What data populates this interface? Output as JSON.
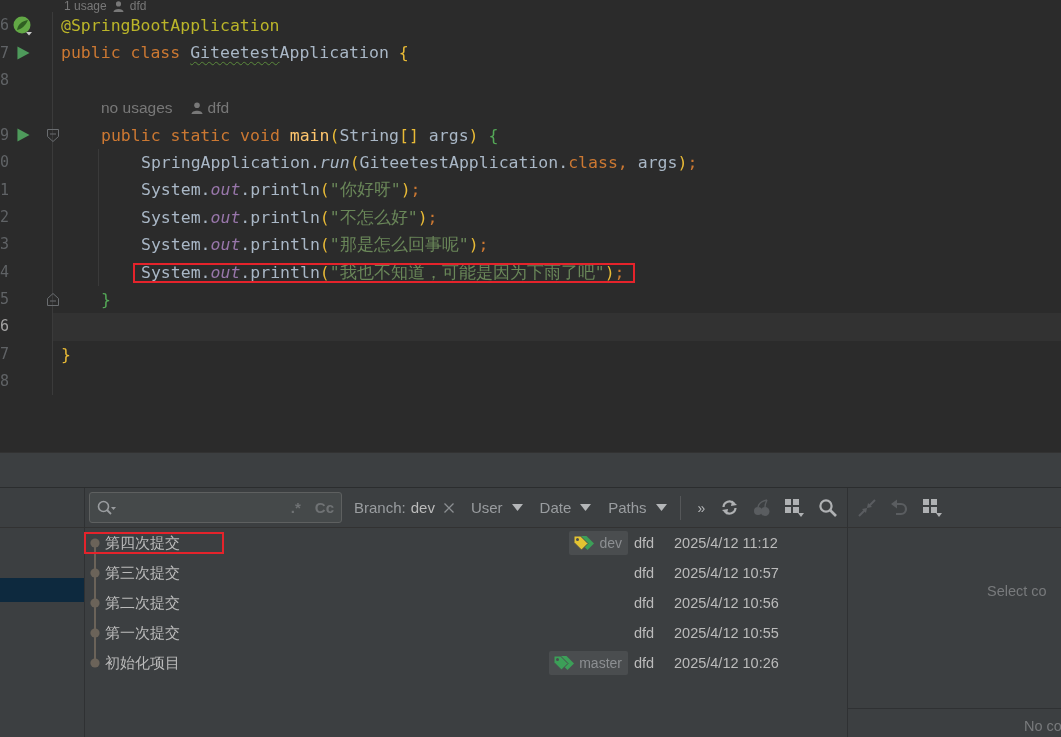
{
  "editor": {
    "top_hint": {
      "usages": "1 usage",
      "author": "dfd"
    },
    "lines": [
      {
        "kind": "code",
        "number": "6",
        "gutter_icon": {
          "kind": "spring"
        },
        "current": false,
        "highlighted": false,
        "tokens": [
          {
            "kind": "annotation",
            "text": "@SpringBootApplication"
          }
        ]
      },
      {
        "kind": "code",
        "number": "7",
        "gutter_icon": {
          "kind": "run"
        },
        "current": false,
        "highlighted": false,
        "tokens": [
          {
            "kind": "keyword",
            "text": "public class "
          },
          {
            "kind": "typo",
            "text": "Giteetest"
          },
          {
            "kind": "plain",
            "text": "Application "
          },
          {
            "kind": "bracket",
            "text": "{"
          }
        ],
        "children": [
          {
            "kind": "code",
            "number": "8",
            "current": false,
            "highlighted": false
          },
          {
            "kind": "hint",
            "usages": "no usages",
            "author": "dfd"
          },
          {
            "kind": "code",
            "number": "9",
            "gutter_icon": {
              "kind": "run"
            },
            "fold_marker": {
              "kind": "open"
            },
            "current": false,
            "highlighted": false,
            "tokens": [
              {
                "kind": "keyword",
                "text": "public static void "
              },
              {
                "kind": "method",
                "text": "main"
              },
              {
                "kind": "bracket",
                "text": "("
              },
              {
                "kind": "plain",
                "text": "String"
              },
              {
                "kind": "bracket",
                "text": "[]"
              },
              {
                "kind": "plain",
                "text": " args"
              },
              {
                "kind": "bracket",
                "text": ")"
              },
              {
                "kind": "bracket-inner",
                "text": " {"
              }
            ],
            "children": [
              {
                "kind": "code",
                "number": "0",
                "current": false,
                "highlighted": false,
                "tokens": [
                  {
                    "kind": "plain",
                    "text": "SpringApplication."
                  },
                  {
                    "kind": "call",
                    "text": "run"
                  },
                  {
                    "kind": "bracket",
                    "text": "("
                  },
                  {
                    "kind": "plain",
                    "text": "GiteetestApplication."
                  },
                  {
                    "kind": "keyword",
                    "text": "class, "
                  },
                  {
                    "kind": "plain",
                    "text": "args"
                  },
                  {
                    "kind": "bracket",
                    "text": ")"
                  },
                  {
                    "kind": "keyword",
                    "text": ";"
                  }
                ]
              },
              {
                "kind": "code",
                "number": "1",
                "current": false,
                "highlighted": false,
                "tokens": [
                  {
                    "kind": "plain",
                    "text": "System."
                  },
                  {
                    "kind": "field",
                    "text": "out"
                  },
                  {
                    "kind": "plain",
                    "text": ".println"
                  },
                  {
                    "kind": "bracket",
                    "text": "("
                  },
                  {
                    "kind": "string",
                    "text": "\"你好呀\""
                  },
                  {
                    "kind": "bracket",
                    "text": ")"
                  },
                  {
                    "kind": "keyword",
                    "text": ";"
                  }
                ]
              },
              {
                "kind": "code",
                "number": "2",
                "current": false,
                "highlighted": false,
                "tokens": [
                  {
                    "kind": "plain",
                    "text": "System."
                  },
                  {
                    "kind": "field",
                    "text": "out"
                  },
                  {
                    "kind": "plain",
                    "text": ".println"
                  },
                  {
                    "kind": "bracket",
                    "text": "("
                  },
                  {
                    "kind": "string",
                    "text": "\"不怎么好\""
                  },
                  {
                    "kind": "bracket",
                    "text": ")"
                  },
                  {
                    "kind": "keyword",
                    "text": ";"
                  }
                ]
              },
              {
                "kind": "code",
                "number": "3",
                "current": false,
                "highlighted": false,
                "tokens": [
                  {
                    "kind": "plain",
                    "text": "System."
                  },
                  {
                    "kind": "field",
                    "text": "out"
                  },
                  {
                    "kind": "plain",
                    "text": ".println"
                  },
                  {
                    "kind": "bracket",
                    "text": "("
                  },
                  {
                    "kind": "string",
                    "text": "\"那是怎么回事呢\""
                  },
                  {
                    "kind": "bracket",
                    "text": ")"
                  },
                  {
                    "kind": "keyword",
                    "text": ";"
                  }
                ]
              },
              {
                "kind": "code",
                "number": "4",
                "current": false,
                "highlighted": true,
                "tokens": [
                  {
                    "kind": "plain",
                    "text": "System."
                  },
                  {
                    "kind": "field",
                    "text": "out"
                  },
                  {
                    "kind": "plain",
                    "text": ".println"
                  },
                  {
                    "kind": "bracket",
                    "text": "("
                  },
                  {
                    "kind": "string",
                    "text": "\"我也不知道，可能是因为下雨了吧\""
                  },
                  {
                    "kind": "bracket",
                    "text": ")"
                  },
                  {
                    "kind": "keyword",
                    "text": ";"
                  }
                ]
              }
            ]
          },
          {
            "kind": "code",
            "number": "5",
            "fold_marker": {
              "kind": "close"
            },
            "current": false,
            "highlighted": false,
            "tokens": [
              {
                "kind": "bracket-inner",
                "text": "}"
              }
            ]
          }
        ]
      },
      {
        "kind": "code",
        "number": "6",
        "current": true,
        "highlighted": false
      },
      {
        "kind": "code",
        "number": "7",
        "current": false,
        "highlighted": false,
        "tokens": [
          {
            "kind": "bracket",
            "text": "}"
          }
        ]
      },
      {
        "kind": "code",
        "number": "8",
        "current": false,
        "highlighted": false
      }
    ]
  },
  "vcs_log": {
    "branch_tree": {
      "items": [
        {
          "selected": false
        },
        {
          "selected": false
        },
        {
          "selected": true
        }
      ]
    },
    "search": {
      "toggles": [
        ".*",
        "Cc"
      ]
    },
    "filters": [
      {
        "kind": "value",
        "label": "Branch:",
        "value": "dev"
      },
      {
        "kind": "dropdown",
        "label": "User"
      },
      {
        "kind": "dropdown",
        "label": "Date"
      },
      {
        "kind": "dropdown",
        "label": "Paths"
      }
    ],
    "overflow": "»",
    "tools": [
      {
        "kind": "refresh",
        "disabled": false
      },
      {
        "kind": "cherry-pick",
        "disabled": true
      },
      {
        "kind": "layout",
        "disabled": false
      },
      {
        "kind": "search",
        "disabled": false
      }
    ],
    "commits": [
      {
        "message": "第四次提交",
        "refs": [
          {
            "label": "dev",
            "current": true
          }
        ],
        "author": "dfd",
        "date": "2025/4/12 11:12",
        "highlighted": true
      },
      {
        "message": "第三次提交",
        "author": "dfd",
        "date": "2025/4/12 10:57",
        "highlighted": false
      },
      {
        "message": "第二次提交",
        "author": "dfd",
        "date": "2025/4/12 10:56",
        "highlighted": false
      },
      {
        "message": "第一次提交",
        "author": "dfd",
        "date": "2025/4/12 10:55",
        "highlighted": false
      },
      {
        "message": "初始化项目",
        "refs": [
          {
            "label": "master",
            "current": false
          }
        ],
        "author": "dfd",
        "date": "2025/4/12 10:26",
        "highlighted": false
      }
    ]
  },
  "details": {
    "tools": [
      {
        "kind": "collapse",
        "disabled": true
      },
      {
        "kind": "undo",
        "disabled": true
      },
      {
        "kind": "layout",
        "disabled": false
      }
    ],
    "empty_text": "Select co",
    "footer_text": "No co"
  }
}
